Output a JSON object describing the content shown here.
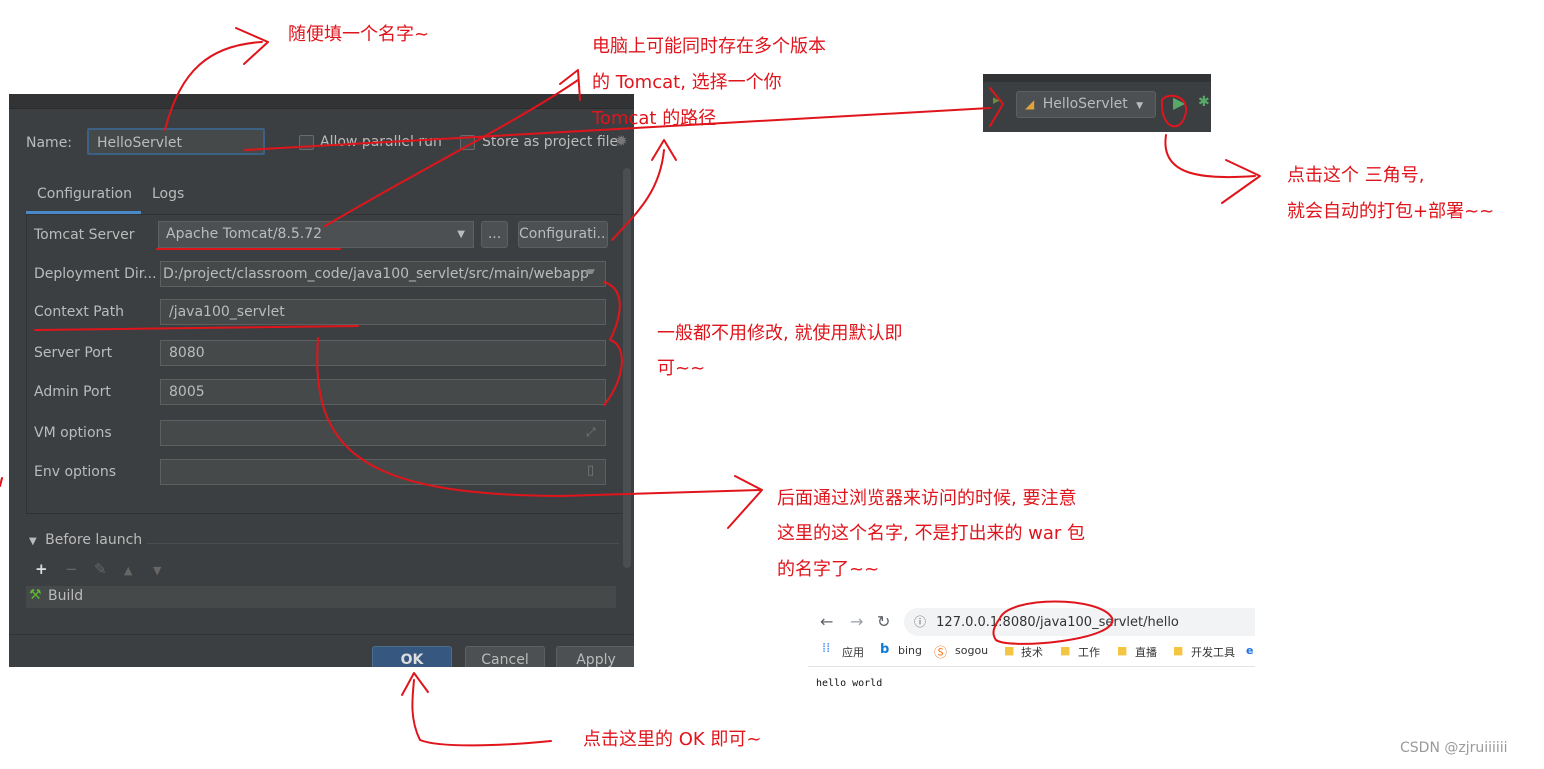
{
  "dialog": {
    "name_label": "Name:",
    "name_value": "HelloServlet",
    "allow_parallel": "Allow parallel run",
    "store_project": "Store as project file",
    "tabs": [
      "Configuration",
      "Logs"
    ],
    "tomcat_server_label": "Tomcat Server",
    "tomcat_server_value": "Apache Tomcat/8.5.72",
    "ellipsis_button": "...",
    "configure_button": "Configurati...",
    "deploy_dir_label": "Deployment Dir...",
    "deploy_dir_value": "D:/project/classroom_code/java100_servlet/src/main/webapp",
    "context_path_label": "Context Path",
    "context_path_value": "/java100_servlet",
    "server_port_label": "Server Port",
    "server_port_value": "8080",
    "admin_port_label": "Admin Port",
    "admin_port_value": "8005",
    "vm_options_label": "VM options",
    "env_options_label": "Env options",
    "before_launch": "Before launch",
    "build_item": "Build",
    "ok": "OK",
    "cancel": "Cancel",
    "apply": "Apply"
  },
  "runbar": {
    "config_name": "HelloServlet"
  },
  "browser": {
    "url": "127.0.0.1:8080/java100_servlet/hello",
    "bookmarks": [
      "应用",
      "bing",
      "sogou",
      "技术",
      "工作",
      "直播",
      "开发工具"
    ],
    "page_text": "hello world"
  },
  "annotations": {
    "name_note": "随便填一个名字~",
    "tomcat_note_1": "电脑上可能同时存在多个版本",
    "tomcat_note_2": "的 Tomcat, 选择一个你",
    "tomcat_note_3": "Tomcat 的路径",
    "run_note_1": "点击这个 三角号,",
    "run_note_2": "就会自动的打包+部署~~",
    "default_note_1": "一般都不用修改, 就使用默认即",
    "default_note_2": "可~~",
    "context_note_1": "后面通过浏览器来访问的时候, 要注意",
    "context_note_2": "这里的这个名字, 不是打出来的 war 包",
    "context_note_3": "的名字了~~",
    "ok_note": "点击这里的 OK 即可~"
  },
  "watermark": "CSDN @zjruiiiiii",
  "colors": {
    "annotation": "#e0151c",
    "ide_bg": "#3c3f41",
    "ok_button": "#365880"
  }
}
